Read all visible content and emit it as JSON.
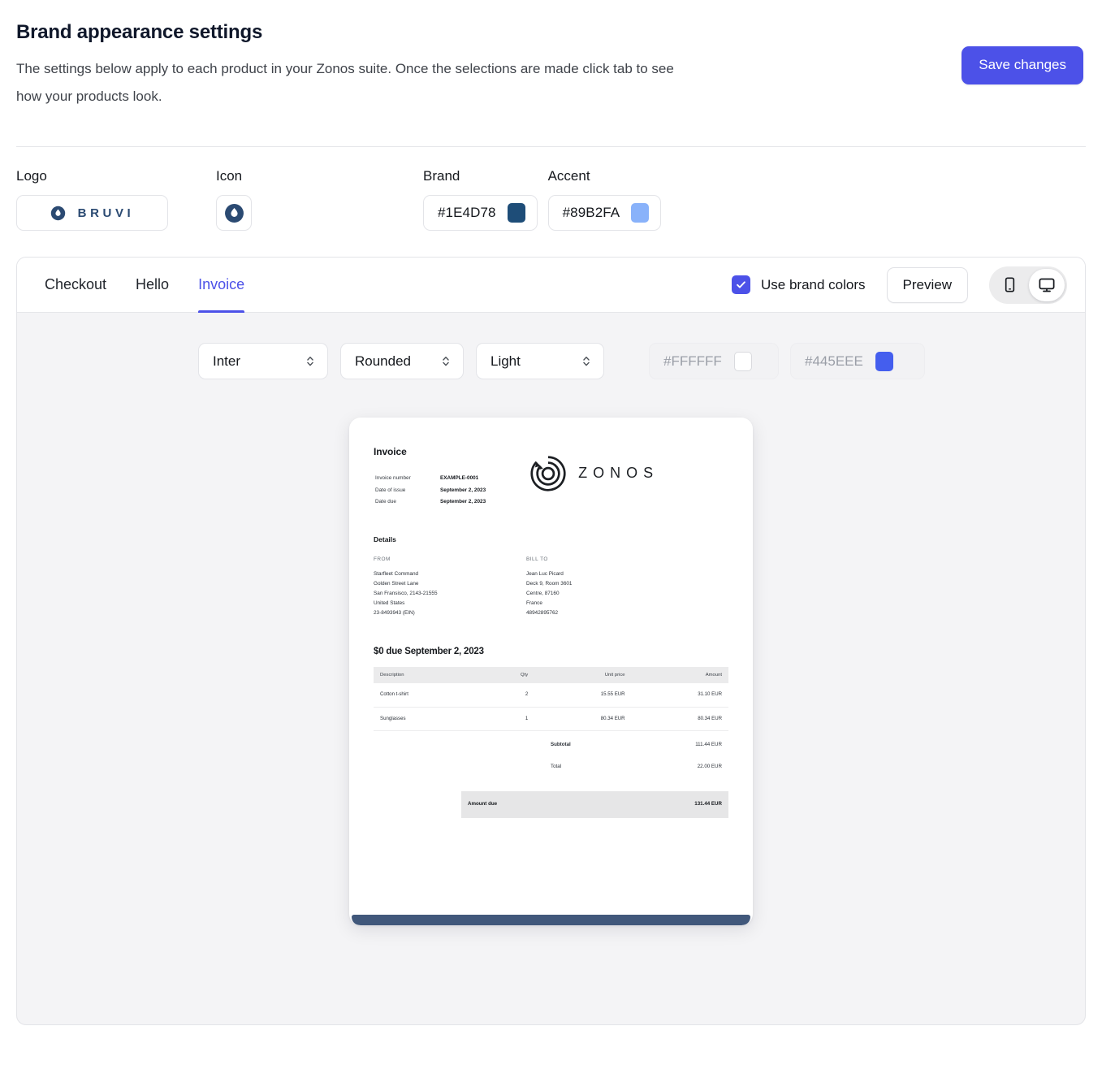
{
  "header": {
    "title": "Brand appearance settings",
    "subtitle": "The settings below apply to each product in your Zonos suite. Once the selections are made click tab to see how your products look.",
    "save_label": "Save changes"
  },
  "brand_row": {
    "logo_label": "Logo",
    "logo_wordmark": "BRUVI",
    "icon_label": "Icon",
    "brand_label": "Brand",
    "brand_hex": "#1E4D78",
    "accent_label": "Accent",
    "accent_hex": "#89B2FA"
  },
  "panel": {
    "tabs": [
      {
        "label": "Checkout",
        "active": false
      },
      {
        "label": "Hello",
        "active": false
      },
      {
        "label": "Invoice",
        "active": true
      }
    ],
    "use_brand_colors_label": "Use brand colors",
    "use_brand_colors_checked": true,
    "preview_label": "Preview",
    "device_mobile": "mobile-view",
    "device_desktop": "desktop-view",
    "device_selected": "desktop"
  },
  "controls": {
    "font_select": "Inter",
    "shape_select": "Rounded",
    "theme_select": "Light",
    "background_hex": "#FFFFFF",
    "primary_hex": "#445EEE"
  },
  "invoice": {
    "title": "Invoice",
    "meta": [
      {
        "key": "Invoice number",
        "value": "EXAMPLE-0001"
      },
      {
        "key": "Date of issue",
        "value": "September 2, 2023"
      },
      {
        "key": "Date due",
        "value": "September 2, 2023"
      }
    ],
    "brand_word": "ZONOS",
    "details_title": "Details",
    "from_heading": "FROM",
    "from_lines": [
      "Starfleet Command",
      "Golden Street Lane",
      "San Fransisco, 2143-21555",
      "United States",
      "23-8493943 (EIN)"
    ],
    "bill_to_heading": "BILL TO",
    "bill_to_lines": [
      "Jean Luc Picard",
      "Deck 9, Room 3601",
      "Centre, 87160",
      "France",
      "48942895762"
    ],
    "due_title": "$0 due September 2, 2023",
    "columns": [
      "Description",
      "Qty",
      "Unit price",
      "Amount"
    ],
    "rows": [
      {
        "description": "Cotton t-shirt",
        "qty": "2",
        "unit_price": "15.55 EUR",
        "amount": "31.10 EUR"
      },
      {
        "description": "Sunglasses",
        "qty": "1",
        "unit_price": "80.34 EUR",
        "amount": "80.34 EUR"
      }
    ],
    "subtotal_label": "Subtotal",
    "subtotal_value": "111.44 EUR",
    "total_label": "Total",
    "total_value": "22.00 EUR",
    "amount_due_label": "Amount due",
    "amount_due_value": "131.44 EUR"
  },
  "colors": {
    "accent_indigo": "#4C51E8",
    "brand_navy": "#1E4D78",
    "brand_accent_blue": "#89B2FA",
    "doc_footer": "#41587B",
    "primary_swatch": "#445EEE"
  }
}
